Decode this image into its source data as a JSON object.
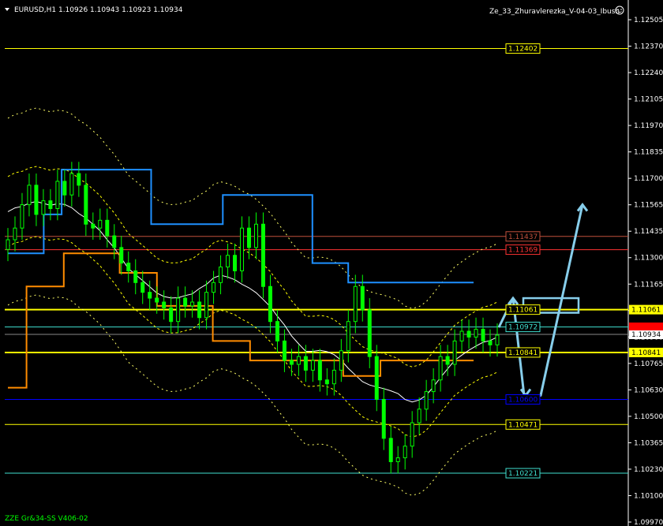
{
  "window": {
    "symbol_line": "EURUSD,H1  1.10926 1.10943 1.10923 1.10934",
    "expert_label": "Ze_33_Zhuravlerezka_V-04-03_Ibush",
    "footer_label": "ZZE Gr&34-SS V406-02",
    "smiley_icon": "smiley-icon",
    "dropdown_icon": "triangle-down-icon"
  },
  "colors": {
    "background": "#000000",
    "candle": "#00ff00",
    "upper_channel": "#1e90ff",
    "lower_channel": "#ff8c00",
    "level_yellow": "#ffff00",
    "level_red": "#ff3333",
    "level_blue": "#0000ff",
    "level_cyan": "#40e0d0",
    "arrow": "#87ceeb"
  },
  "price_axis": {
    "min": 1.0997,
    "max": 1.1255,
    "ticks": [
      "1.12505",
      "1.12370",
      "1.12240",
      "1.12105",
      "1.11970",
      "1.11835",
      "1.11700",
      "1.11565",
      "1.11435",
      "1.11300",
      "1.11165",
      "1.11035",
      "1.10900",
      "1.10765",
      "1.10630",
      "1.10500",
      "1.10365",
      "1.10230",
      "1.10100",
      "1.09970"
    ],
    "current_price": "1.10934",
    "hidden_red_label": "1.10950"
  },
  "levels": [
    {
      "price": 1.12402,
      "label": "1.12402",
      "color": "#ffff00",
      "style": "thin",
      "has_box": true
    },
    {
      "price": 1.11437,
      "label": "1.11437",
      "color": "#c0503c",
      "style": "thin",
      "has_box": true
    },
    {
      "price": 1.11369,
      "label": "1.11369",
      "color": "#ff3333",
      "style": "thin",
      "has_box": true
    },
    {
      "price": 1.11061,
      "label": "1.11061",
      "color": "#ffff00",
      "style": "thick",
      "has_box": true,
      "axis_box": true
    },
    {
      "price": 1.10972,
      "label": "1.10972",
      "color": "#40e0d0",
      "style": "thin",
      "has_box": true
    },
    {
      "price": 1.10841,
      "label": "1.10841",
      "color": "#ffff00",
      "style": "thick",
      "has_box": true,
      "axis_box": true
    },
    {
      "price": 1.106,
      "label": "1.10600",
      "color": "#0000ff",
      "style": "thin",
      "has_box": true
    },
    {
      "price": 1.10471,
      "label": "1.10471",
      "color": "#ffff00",
      "style": "thin",
      "has_box": true
    },
    {
      "price": 1.10221,
      "label": "1.10221",
      "color": "#40e0d0",
      "style": "thin",
      "has_box": true
    }
  ],
  "chart_data": {
    "type": "candlestick",
    "symbol": "EURUSD",
    "timeframe": "H1",
    "ylim": [
      1.0997,
      1.1255
    ],
    "closes": [
      1.1142,
      1.1148,
      1.116,
      1.117,
      1.1155,
      1.1162,
      1.1158,
      1.1172,
      1.1165,
      1.1176,
      1.117,
      1.115,
      1.1148,
      1.1152,
      1.1144,
      1.1138,
      1.113,
      1.1126,
      1.112,
      1.1115,
      1.1112,
      1.111,
      1.1107,
      1.11,
      1.1112,
      1.1108,
      1.111,
      1.1102,
      1.1115,
      1.112,
      1.1128,
      1.1134,
      1.1126,
      1.1148,
      1.1138,
      1.115,
      1.1118,
      1.11,
      1.109,
      1.108,
      1.1078,
      1.1082,
      1.1075,
      1.108,
      1.107,
      1.1068,
      1.1075,
      1.1085,
      1.11,
      1.1118,
      1.1106,
      1.1082,
      1.106,
      1.104,
      1.1028,
      1.103,
      1.1036,
      1.1048,
      1.1055,
      1.1064,
      1.107,
      1.1082,
      1.1078,
      1.109,
      1.1095,
      1.1092,
      1.1096,
      1.109,
      1.1088,
      1.1093
    ],
    "upper_channel_price": [
      1.1135,
      1.1135,
      1.1155,
      1.1178,
      1.1178,
      1.1178,
      1.1178,
      1.1178,
      1.115,
      1.115,
      1.115,
      1.115,
      1.1165,
      1.1165,
      1.1165,
      1.1165,
      1.1165,
      1.113,
      1.113,
      1.112,
      1.112,
      1.112,
      1.112,
      1.112,
      1.112,
      1.112
    ],
    "lower_channel_price": [
      1.1066,
      1.1118,
      1.1118,
      1.1135,
      1.1135,
      1.1135,
      1.1125,
      1.1125,
      1.1108,
      1.1108,
      1.1108,
      1.109,
      1.109,
      1.108,
      1.108,
      1.108,
      1.108,
      1.108,
      1.1072,
      1.1072,
      1.108,
      1.108,
      1.108,
      1.108,
      1.108
    ],
    "forecast_path": [
      1.1097,
      1.1112,
      1.1062,
      1.1062,
      1.1112,
      1.116
    ],
    "forecast_box": {
      "price_top": 1.1112,
      "price_bottom": 1.11045
    }
  }
}
